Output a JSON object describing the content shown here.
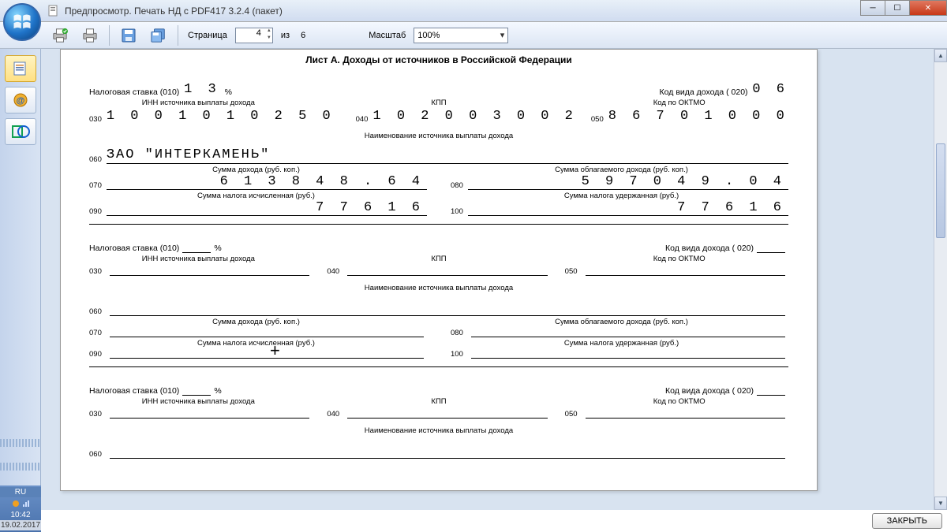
{
  "window": {
    "title": "Предпросмотр. Печать НД с PDF417 3.2.4 (пакет)"
  },
  "toolbar": {
    "page_label": "Страница",
    "page_value": "4",
    "of_label": "из",
    "page_total": "6",
    "zoom_label": "Масштаб",
    "zoom_value": "100%"
  },
  "doc": {
    "title": "Лист А. Доходы от источников в Российской Федерации",
    "labels": {
      "rate": "Налоговая ставка (010)",
      "percent": "%",
      "income_code": "Код вида дохода ( 020)",
      "inn": "ИНН источника выплаты дохода",
      "kpp": "КПП",
      "oktmo": "Код по ОКТМО",
      "source_name": "Наименование источника выплаты дохода",
      "income_sum": "Сумма дохода (руб. коп.)",
      "taxable_sum": "Сумма облагаемого дохода (руб. коп.)",
      "tax_calc": "Сумма налога исчисленная (руб.)",
      "tax_held": "Сумма налога удержанная (руб.)"
    },
    "codes": {
      "c030": "030",
      "c040": "040",
      "c050": "050",
      "c060": "060",
      "c070": "070",
      "c080": "080",
      "c090": "090",
      "c100": "100"
    },
    "block1": {
      "rate": "1 3",
      "income_code": "0 6",
      "inn": "1 0 0 1 0 1 0 2 5 0",
      "kpp": "1 0 2 0 0 3 0 0 2",
      "oktmo": "8 6 7 0 1 0 0 0",
      "name": "ЗАО \"ИНТЕРКАМЕНЬ\"",
      "income": "6 1 3 8 4 8 . 6 4",
      "taxable": "5 9 7 0 4 9 . 0 4",
      "tax_calc": "7 7 6 1 6",
      "tax_held": "7 7 6 1 6"
    }
  },
  "footer": {
    "close": "ЗАКРЫТЬ"
  },
  "tray": {
    "lang": "RU",
    "time": "10:42",
    "date": "19.02.2017"
  }
}
